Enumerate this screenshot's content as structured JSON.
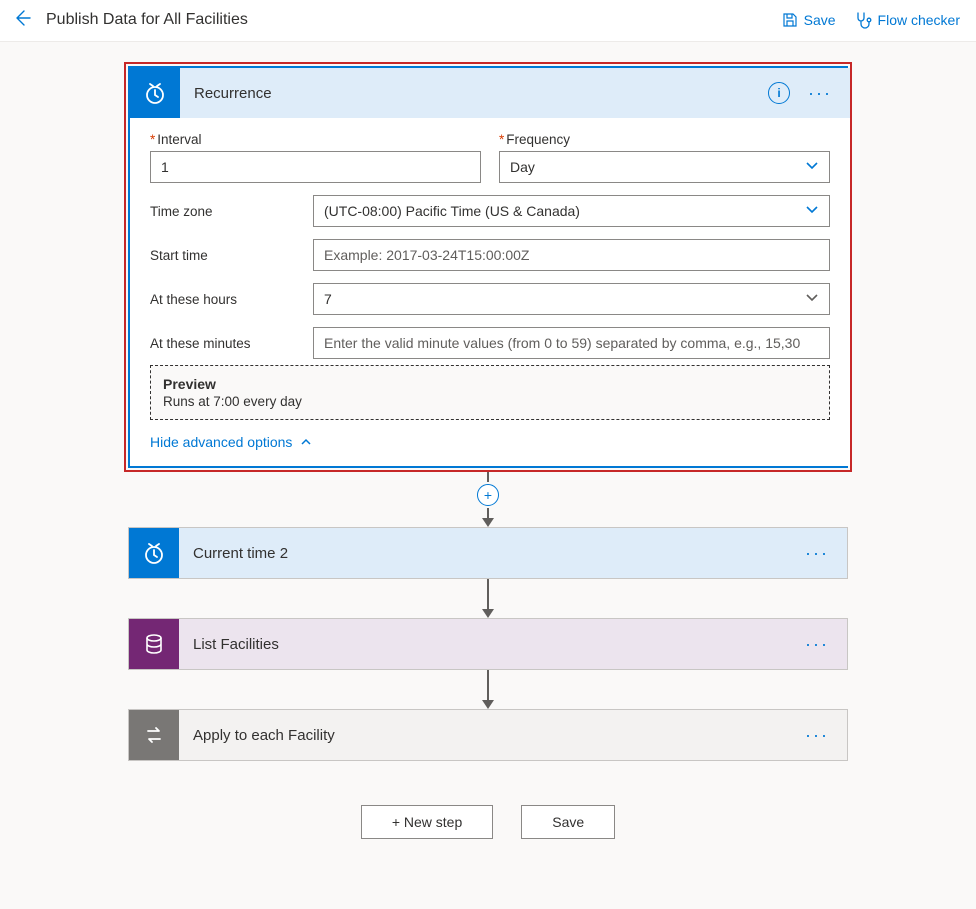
{
  "header": {
    "title": "Publish Data for All Facilities",
    "save_label": "Save",
    "flow_checker_label": "Flow checker"
  },
  "recurrence": {
    "title": "Recurrence",
    "interval_label": "Interval",
    "interval_value": "1",
    "frequency_label": "Frequency",
    "frequency_value": "Day",
    "timezone_label": "Time zone",
    "timezone_value": "(UTC-08:00) Pacific Time (US & Canada)",
    "starttime_label": "Start time",
    "starttime_placeholder": "Example: 2017-03-24T15:00:00Z",
    "hours_label": "At these hours",
    "hours_value": "7",
    "minutes_label": "At these minutes",
    "minutes_placeholder": "Enter the valid minute values (from 0 to 59) separated by comma, e.g., 15,30",
    "preview_title": "Preview",
    "preview_text": "Runs at 7:00 every day",
    "hide_adv_label": "Hide advanced options"
  },
  "steps": {
    "current_time": "Current time 2",
    "list_facilities": "List Facilities",
    "apply_each": "Apply to each Facility"
  },
  "footer": {
    "new_step": "+ New step",
    "save": "Save"
  }
}
